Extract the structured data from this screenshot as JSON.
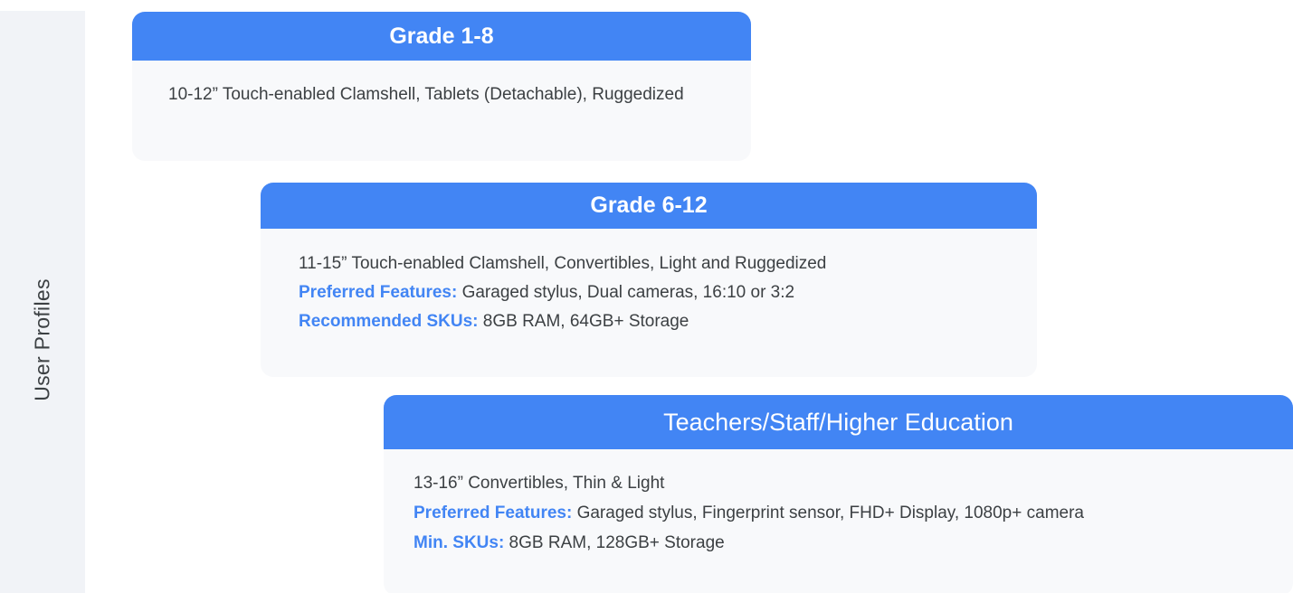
{
  "side": {
    "label": "User Profiles"
  },
  "cards": [
    {
      "title": "Grade 1-8",
      "lines": [
        {
          "text": "10-12” Touch-enabled Clamshell, Tablets (Detachable), Ruggedized"
        }
      ]
    },
    {
      "title": "Grade 6-12",
      "lines": [
        {
          "text": "11-15” Touch-enabled Clamshell, Convertibles, Light and Ruggedized"
        },
        {
          "key": "Preferred Features:",
          "text": " Garaged stylus, Dual cameras, 16:10 or 3:2"
        },
        {
          "key": "Recommended SKUs:",
          "text": " 8GB RAM, 64GB+ Storage"
        }
      ]
    },
    {
      "title": "Teachers/Staff/Higher Education",
      "lines": [
        {
          "text": "13-16” Convertibles, Thin & Light"
        },
        {
          "key": "Preferred Features:",
          "text": " Garaged stylus, Fingerprint sensor, FHD+ Display, 1080p+ camera"
        },
        {
          "key": "Min. SKUs:",
          "text": " 8GB RAM, 128GB+ Storage"
        }
      ]
    }
  ],
  "colors": {
    "header": "#4285f4",
    "card_bg": "#f8f9fb",
    "side_bg": "#f1f3f7",
    "text": "#3c4043",
    "key_text": "#4285f4"
  }
}
